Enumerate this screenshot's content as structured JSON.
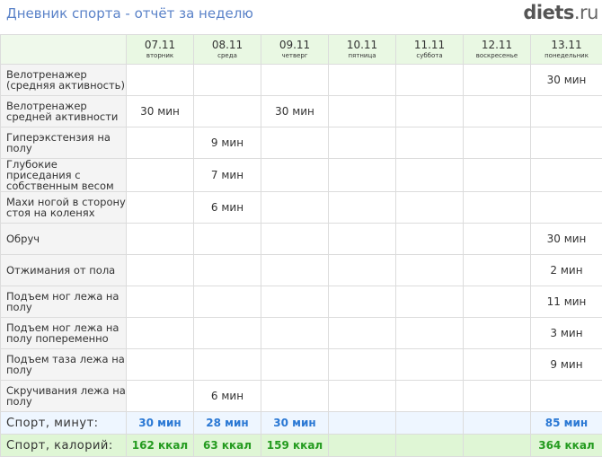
{
  "header": {
    "title": "Дневник спорта - отчёт за неделю",
    "logo_main": "diets",
    "logo_tld": ".ru"
  },
  "days": [
    {
      "date": "07.11",
      "weekday": "вторник"
    },
    {
      "date": "08.11",
      "weekday": "среда"
    },
    {
      "date": "09.11",
      "weekday": "четверг"
    },
    {
      "date": "10.11",
      "weekday": "пятница"
    },
    {
      "date": "11.11",
      "weekday": "суббота"
    },
    {
      "date": "12.11",
      "weekday": "воскресенье"
    },
    {
      "date": "13.11",
      "weekday": "понедельник"
    }
  ],
  "exercises": [
    {
      "name": "Велотренажер (средняя активность)",
      "values": [
        "",
        "",
        "",
        "",
        "",
        "",
        "30 мин"
      ]
    },
    {
      "name": "Велотренажер средней активности",
      "values": [
        "30 мин",
        "",
        "30 мин",
        "",
        "",
        "",
        ""
      ]
    },
    {
      "name": "Гиперэкстензия на полу",
      "values": [
        "",
        "9 мин",
        "",
        "",
        "",
        "",
        ""
      ]
    },
    {
      "name": "Глубокие приседания с собственным весом",
      "values": [
        "",
        "7 мин",
        "",
        "",
        "",
        "",
        ""
      ]
    },
    {
      "name": "Махи ногой в сторону стоя на коленях",
      "values": [
        "",
        "6 мин",
        "",
        "",
        "",
        "",
        ""
      ]
    },
    {
      "name": "Обруч",
      "values": [
        "",
        "",
        "",
        "",
        "",
        "",
        "30 мин"
      ]
    },
    {
      "name": "Отжимания от пола",
      "values": [
        "",
        "",
        "",
        "",
        "",
        "",
        "2 мин"
      ]
    },
    {
      "name": "Подъем ног лежа на полу",
      "values": [
        "",
        "",
        "",
        "",
        "",
        "",
        "11 мин"
      ]
    },
    {
      "name": "Подъем ног лежа на полу попеременно",
      "values": [
        "",
        "",
        "",
        "",
        "",
        "",
        "3 мин"
      ]
    },
    {
      "name": "Подъем таза лежа на полу",
      "values": [
        "",
        "",
        "",
        "",
        "",
        "",
        "9 мин"
      ]
    },
    {
      "name": "Скручивания лежа на полу",
      "values": [
        "",
        "6 мин",
        "",
        "",
        "",
        "",
        ""
      ]
    }
  ],
  "totals": {
    "minutes_label": "Спорт, минут:",
    "minutes": [
      "30 мин",
      "28 мин",
      "30 мин",
      "",
      "",
      "",
      "85 мин"
    ],
    "kcal_label": "Спорт, калорий:",
    "kcal": [
      "162 ккал",
      "63 ккал",
      "159 ккал",
      "",
      "",
      "",
      "364 ккал"
    ]
  },
  "colors": {
    "title": "#5a82c8",
    "header_bg": "#e9f8e3",
    "minutes_text": "#2a78d4",
    "kcal_text": "#249b1f",
    "kcal_bg": "#dff6d5"
  }
}
